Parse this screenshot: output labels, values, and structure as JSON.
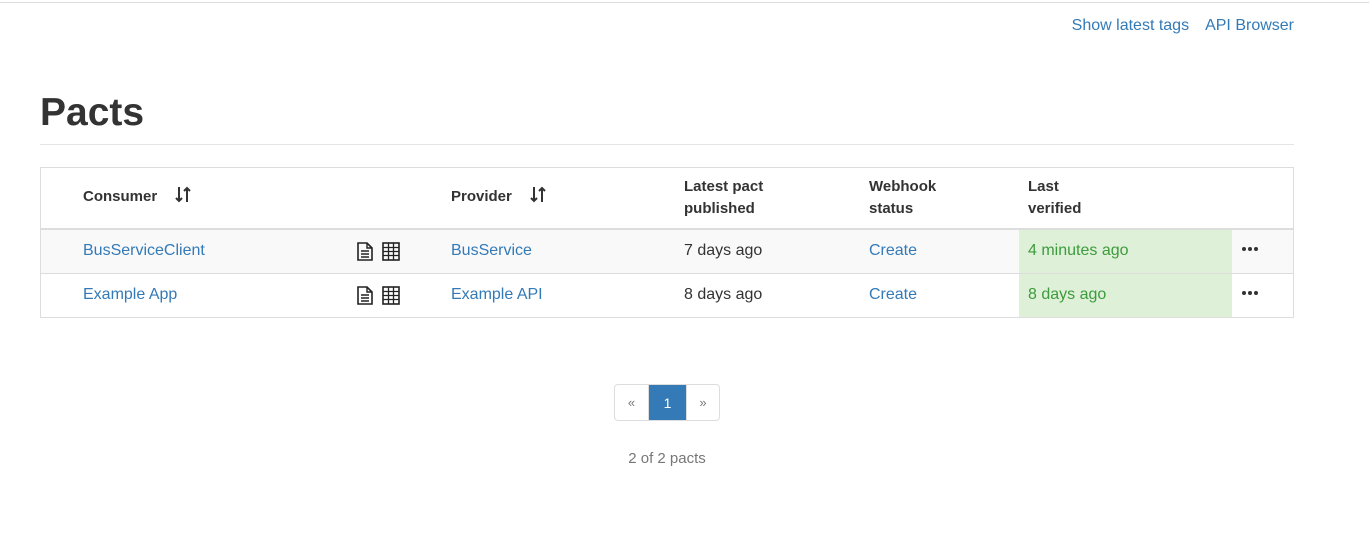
{
  "header": {
    "links": [
      "Show latest tags",
      "API Browser"
    ]
  },
  "page": {
    "title": "Pacts"
  },
  "table": {
    "columns": {
      "consumer": "Consumer",
      "provider": "Provider",
      "published_line1": "Latest pact",
      "published_line2": "published",
      "webhook_line1": "Webhook",
      "webhook_line2": "status",
      "verified_line1": "Last",
      "verified_line2": "verified"
    },
    "rows": [
      {
        "consumer": "BusServiceClient",
        "provider": "BusService",
        "published": "7 days ago",
        "webhook": "Create",
        "verified": "4 minutes ago"
      },
      {
        "consumer": "Example App",
        "provider": "Example API",
        "published": "8 days ago",
        "webhook": "Create",
        "verified": "8 days ago"
      }
    ]
  },
  "pagination": {
    "prev": "«",
    "current": "1",
    "next": "»"
  },
  "summary": "2 of 2 pacts",
  "colors": {
    "link": "#337ab7",
    "verified_bg": "#dff0d8",
    "verified_text": "#3c9b3c",
    "active_page": "#337ab7"
  },
  "icons": [
    "sort-icon",
    "document-icon",
    "matrix-icon",
    "more-options-icon"
  ]
}
